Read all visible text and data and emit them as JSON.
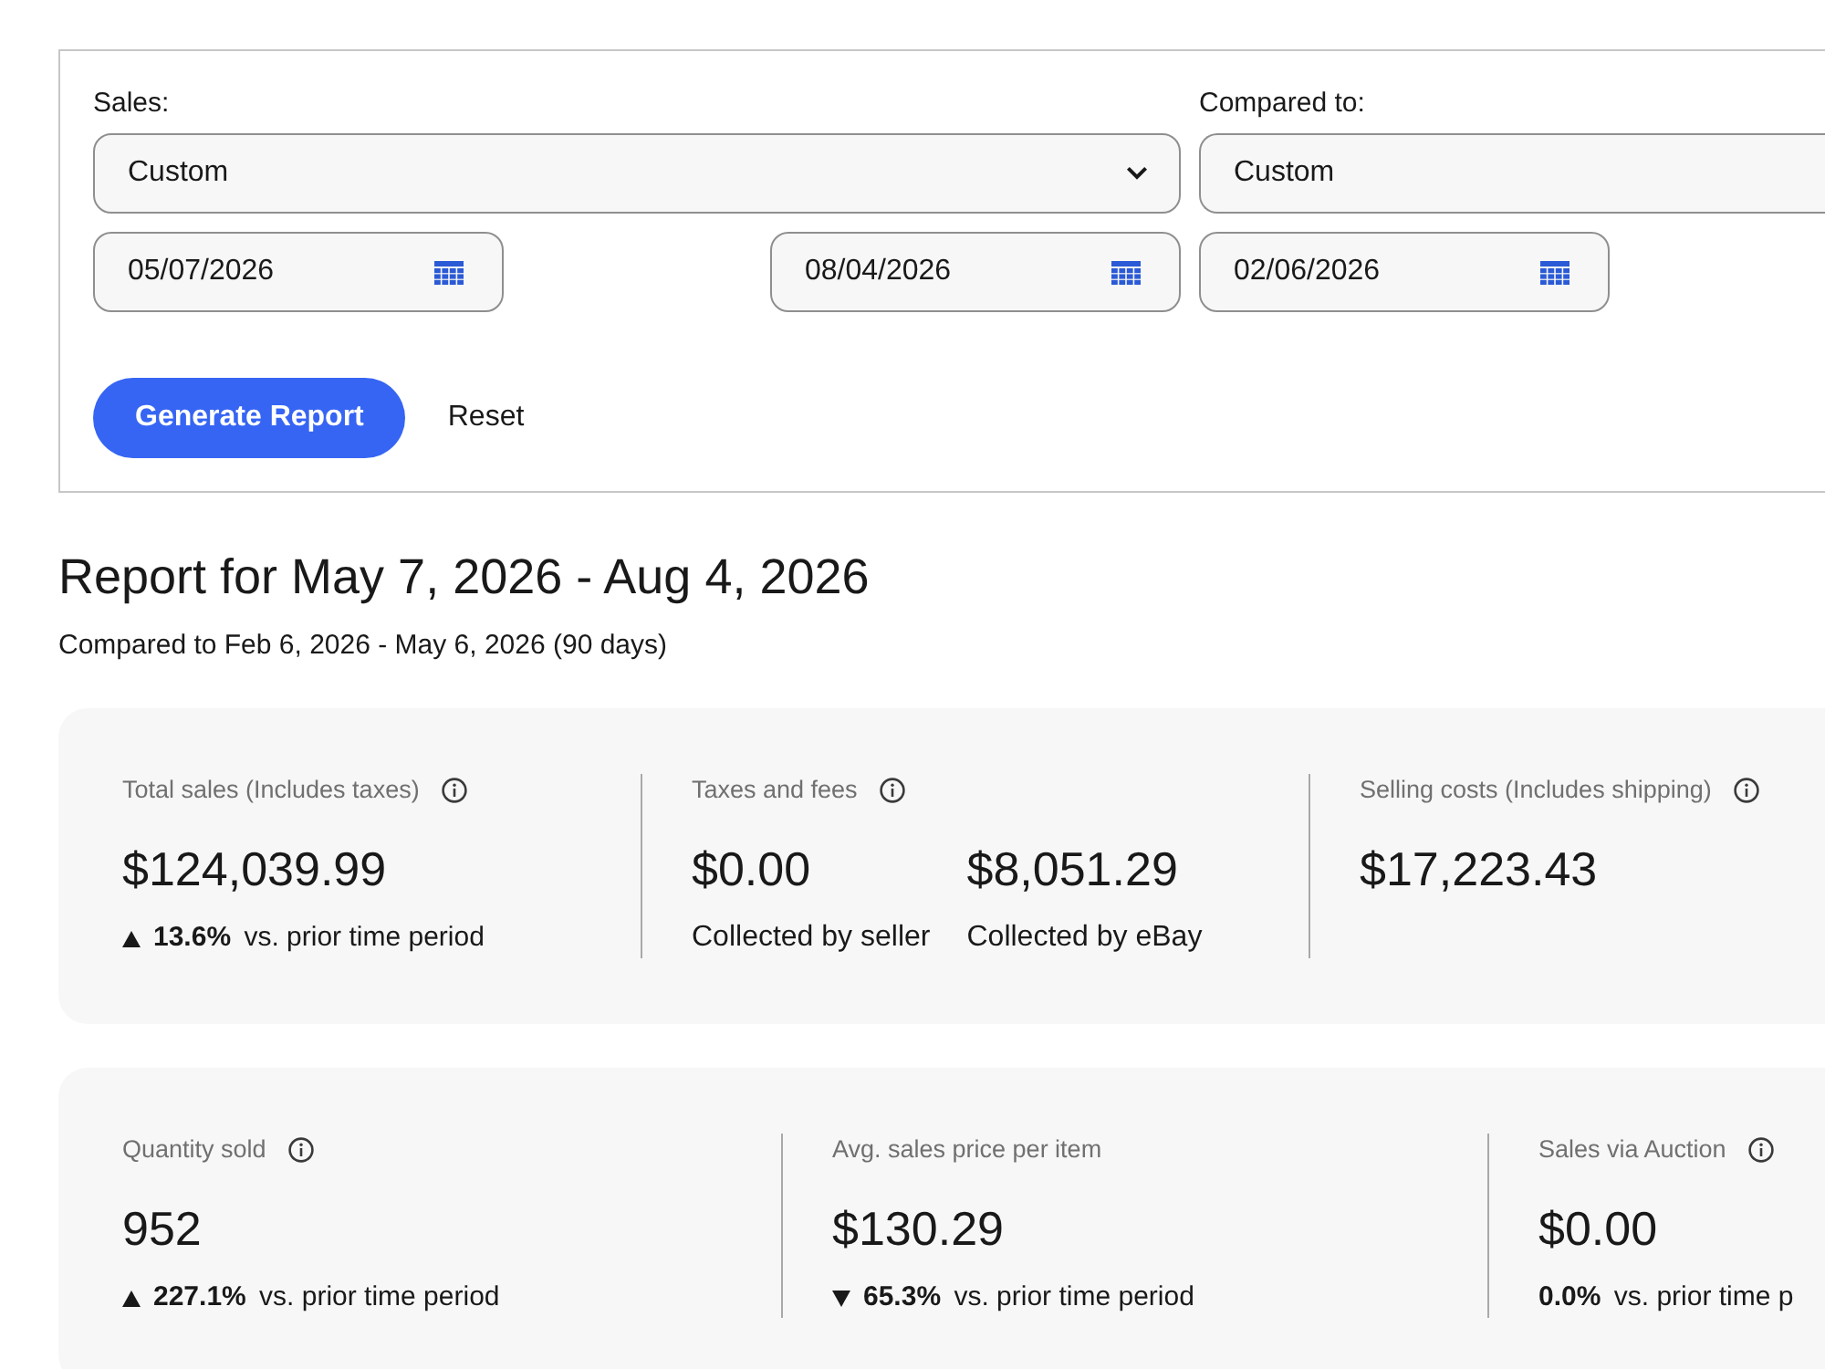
{
  "filters": [
    {
      "label": "Sales:",
      "period": {
        "value": "Custom",
        "caret": true
      },
      "dates": [
        "05/07/2026",
        "08/04/2026"
      ]
    },
    {
      "label": "Compared to:",
      "period": {
        "value": "Custom",
        "caret": false
      },
      "dates": [
        "02/06/2026"
      ]
    }
  ],
  "actions": [
    {
      "label": "Generate Report",
      "kind": "primary"
    },
    {
      "label": "Reset",
      "kind": "link"
    }
  ],
  "report": {
    "title": "Report for May 7, 2026 - Aug 4, 2026",
    "subtitle": "Compared to Feb 6, 2026 - May 6, 2026 (90 days)"
  },
  "metric_cards": [
    {
      "metrics": [
        {
          "label": "Total sales (Includes taxes)",
          "info": true,
          "values": [
            {
              "amount": "$124,039.99"
            }
          ],
          "change": {
            "kind": "up",
            "text": "**13.6%** vs. prior time period"
          }
        },
        {
          "label": "Taxes and fees",
          "info": true,
          "values": [
            {
              "amount": "$0.00",
              "caption": "Collected by seller"
            },
            {
              "amount": "$8,051.29",
              "caption": "Collected by eBay"
            }
          ]
        },
        {
          "label": "Selling costs (Includes shipping)",
          "info": true,
          "values": [
            {
              "amount": "$17,223.43"
            }
          ]
        }
      ]
    },
    {
      "metrics": [
        {
          "label": "Quantity sold",
          "info": true,
          "values": [
            {
              "amount": "952"
            }
          ],
          "change": {
            "kind": "up",
            "text": "**227.1%** vs. prior time period"
          }
        },
        {
          "label": "Avg. sales price per item",
          "info": false,
          "values": [
            {
              "amount": "$130.29"
            }
          ],
          "change": {
            "kind": "down",
            "text": "**65.3%** vs. prior time period"
          }
        },
        {
          "label": "Sales via Auction",
          "info": true,
          "values": [
            {
              "amount": "$0.00"
            }
          ],
          "change": {
            "kind": "flat",
            "text": "**0.0%** vs. prior time p"
          }
        }
      ]
    }
  ]
}
